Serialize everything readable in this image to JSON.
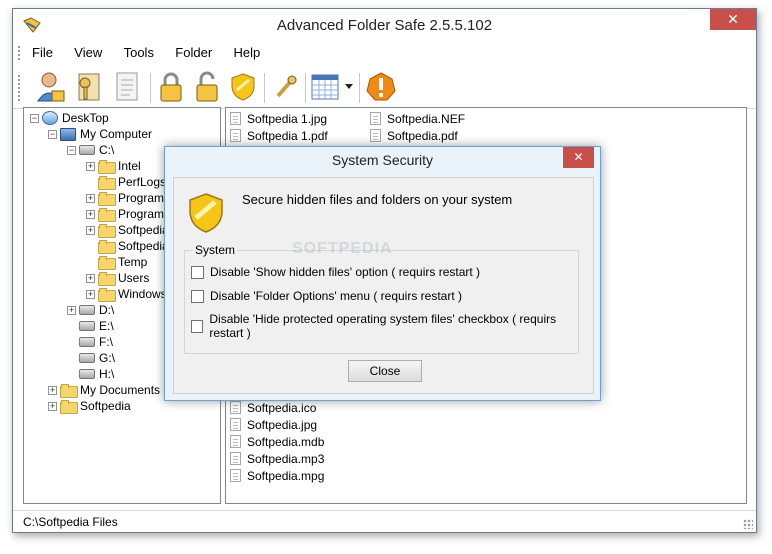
{
  "window": {
    "title": "Advanced Folder Safe 2.5.5.102",
    "close_glyph": "✕"
  },
  "menu": [
    "File",
    "View",
    "Tools",
    "Folder",
    "Help"
  ],
  "toolbar": {
    "icons": [
      "user-lock-icon",
      "key-icon",
      "document-icon",
      "lock-closed-icon",
      "lock-open-icon",
      "shield-icon",
      "wrench-icon",
      "calendar-icon",
      "dropdown-arrow-icon",
      "warning-icon"
    ]
  },
  "tree": {
    "root": "DeskTop",
    "computer": "My Computer",
    "drive_c": "C:\\",
    "c_children": [
      "Intel",
      "PerfLogs",
      "Program",
      "Program",
      "Softpedia",
      "Softpedia",
      "Temp",
      "Users",
      "Windows"
    ],
    "drives": [
      "D:\\",
      "E:\\",
      "F:\\",
      "G:\\",
      "H:\\"
    ],
    "documents": "My Documents",
    "softpedia": "Softpedia"
  },
  "files": {
    "top_left": [
      "Softpedia 1.jpg",
      "Softpedia 1.pdf"
    ],
    "top_right": [
      "Softpedia.NEF",
      "Softpedia.pdf"
    ],
    "bottom": [
      "Softpedia.ico",
      "Softpedia.jpg",
      "Softpedia.mdb",
      "Softpedia.mp3",
      "Softpedia.mpg"
    ]
  },
  "status": {
    "path": "C:\\Softpedia Files"
  },
  "dialog": {
    "title": "System Security",
    "close_glyph": "✕",
    "heading": "Secure hidden files and folders on your system",
    "group_label": "System",
    "options": [
      "Disable 'Show hidden files' option  ( requirs restart )",
      "Disable 'Folder Options' menu  ( requirs restart )",
      "Disable 'Hide protected operating system files' checkbox  ( requirs restart )"
    ],
    "close_button": "Close"
  },
  "watermark": "SOFTPEDIA"
}
